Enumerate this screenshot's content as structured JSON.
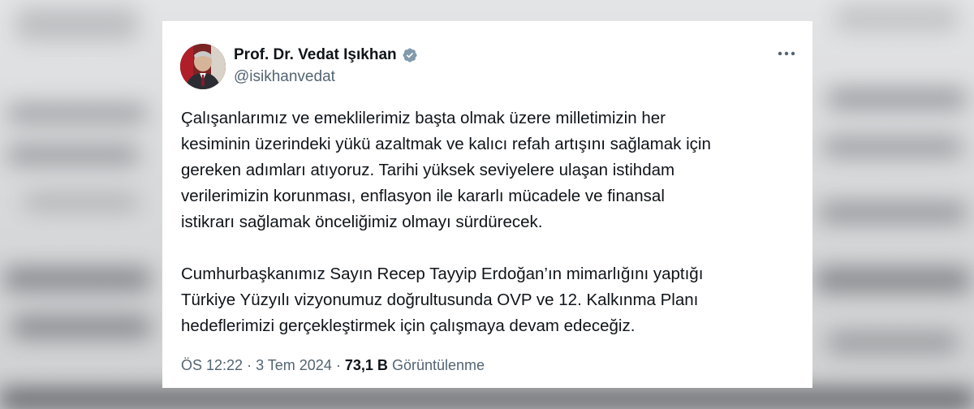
{
  "author": {
    "name": "Prof. Dr. Vedat Işıkhan",
    "handle": "@isikhanvedat",
    "verified_icon": "verified-badge-icon"
  },
  "tweet": {
    "paragraphs": [
      {
        "lines": [
          "Çalışanlarımız ve emeklilerimiz başta olmak üzere milletimizin her",
          "kesiminin üzerindeki yükü azaltmak ve kalıcı refah artışını sağlamak için",
          "gereken adımları atıyoruz. Tarihi yüksek seviyelere ulaşan istihdam",
          "verilerimizin korunması, enflasyon ile kararlı mücadele ve finansal",
          "istikrarı sağlamak önceliğimiz olmayı sürdürecek."
        ]
      },
      {
        "lines": [
          "Cumhurbaşkanımız Sayın Recep Tayyip Erdoğan’ın mimarlığını yaptığı",
          "Türkiye Yüzyılı vizyonumuz doğrultusunda OVP ve 12. Kalkınma Planı",
          "hedeflerimizi gerçekleştirmek için çalışmaya devam edeceğiz."
        ]
      }
    ]
  },
  "meta": {
    "time": "ÖS 12:22",
    "separator": "·",
    "date": "3 Tem 2024",
    "views_count": "73,1 B",
    "views_label": "Görüntülenme"
  },
  "colors": {
    "verified": "#829aab",
    "text": "#0f1419",
    "secondary": "#536471"
  }
}
